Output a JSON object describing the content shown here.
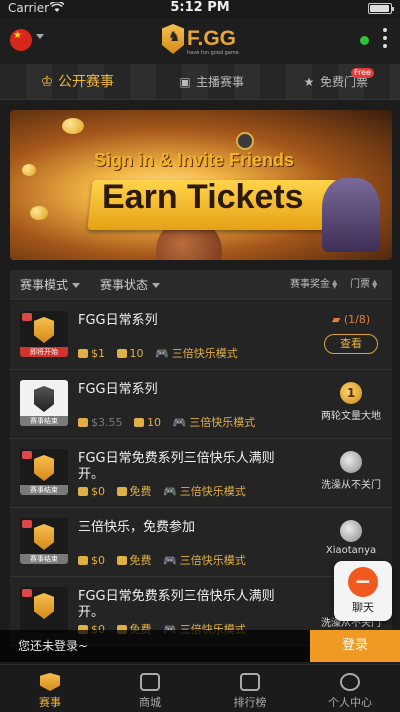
{
  "status_bar": {
    "carrier": "Carrier",
    "time": "5:12 PM"
  },
  "header": {
    "brand": "F.GG",
    "tagline": "have fun good game",
    "flag_icon": "china-flag-icon"
  },
  "tabs": [
    {
      "label": "公开赛事",
      "icon": "trophy-icon",
      "active": true
    },
    {
      "label": "主播赛事",
      "icon": "video-icon",
      "active": false
    },
    {
      "label": "免费门票",
      "icon": "star-icon",
      "active": false,
      "badge": "Free"
    }
  ],
  "banner": {
    "line1": "Sign in  & Invite  Friends",
    "line2": "Earn Tickets"
  },
  "filters": {
    "mode": "赛事模式",
    "status": "赛事状态",
    "prize": "赛事奖金",
    "ticket": "门票"
  },
  "tournaments": [
    {
      "title": "FGG日常系列",
      "tag": "即将开始",
      "tag_type": "live",
      "fee": "$1",
      "tickets": "10",
      "mode": "三倍快乐模式",
      "slots": "(1/8)",
      "action": "查看",
      "winner": ""
    },
    {
      "title": "FGG日常系列",
      "tag": "赛事结束",
      "tag_type": "ended",
      "fee": "$3.55",
      "tickets": "10",
      "mode": "三倍快乐模式",
      "slots": "",
      "action": "",
      "winner": "两轮文量大地"
    },
    {
      "title": "FGG日常免费系列三倍快乐人满则开。",
      "tag": "赛事结束",
      "tag_type": "ended",
      "fee": "$0",
      "tickets": "免费",
      "mode": "三倍快乐模式",
      "slots": "",
      "action": "",
      "winner": "洗澡从不关门"
    },
    {
      "title": "三倍快乐，免费参加",
      "tag": "赛事结束",
      "tag_type": "ended",
      "fee": "$0",
      "tickets": "免费",
      "mode": "三倍快乐模式",
      "slots": "",
      "action": "",
      "winner": "Xiaotanya"
    },
    {
      "title": "FGG日常免费系列三倍快乐人满则开。",
      "tag": "",
      "tag_type": "ended",
      "fee": "$0",
      "tickets": "免费",
      "mode": "三倍快乐模式",
      "slots": "",
      "action": "",
      "winner": "洗澡从不关门"
    }
  ],
  "chat": {
    "label": "聊天"
  },
  "login_bar": {
    "tip": "您还未登录~",
    "button": "登录"
  },
  "bottom_nav": [
    {
      "label": "赛事",
      "icon": "trophy-icon",
      "active": true
    },
    {
      "label": "商城",
      "icon": "store-icon",
      "active": false
    },
    {
      "label": "排行榜",
      "icon": "leaderboard-icon",
      "active": false
    },
    {
      "label": "个人中心",
      "icon": "profile-icon",
      "active": false
    }
  ],
  "colors": {
    "accent": "#f0b73a",
    "login": "#f09a24",
    "live_tag": "#d0342c"
  }
}
